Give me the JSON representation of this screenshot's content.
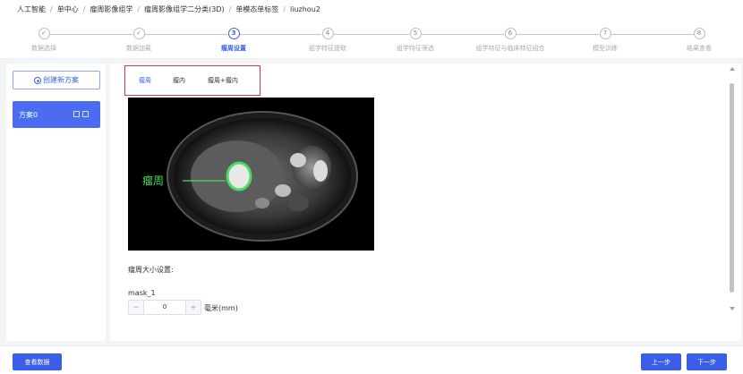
{
  "breadcrumb": [
    "人工智能",
    "单中心",
    "瘤周影像组学",
    "瘤周影像组学二分类(3D)",
    "单模态单标签",
    "liuzhou2"
  ],
  "steps": [
    {
      "num": "✓",
      "label": "数据选择",
      "state": "done"
    },
    {
      "num": "✓",
      "label": "数据加载",
      "state": "done"
    },
    {
      "num": "3",
      "label": "瘤周设置",
      "state": "active"
    },
    {
      "num": "4",
      "label": "组学特征提取",
      "state": "todo"
    },
    {
      "num": "5",
      "label": "组学特征筛选",
      "state": "todo"
    },
    {
      "num": "6",
      "label": "组学特征与临床特征组合",
      "state": "todo"
    },
    {
      "num": "7",
      "label": "模型训练",
      "state": "todo"
    },
    {
      "num": "8",
      "label": "结果查看",
      "state": "todo"
    }
  ],
  "sidebar": {
    "create_label": "创建新方案",
    "plans": [
      {
        "name": "方案0"
      }
    ]
  },
  "tabs": [
    {
      "label": "瘤周",
      "active": true
    },
    {
      "label": "瘤内",
      "active": false
    },
    {
      "label": "瘤周+瘤内",
      "active": false
    }
  ],
  "image": {
    "annotation": "瘤周",
    "annotation_color": "#4cd964"
  },
  "settings": {
    "title": "瘤周大小设置:",
    "mask_label": "mask_1",
    "value": "0",
    "minus": "−",
    "plus": "+",
    "unit": "毫米(mm)"
  },
  "footer": {
    "view_data": "查看数据",
    "prev": "上一步",
    "next": "下一步"
  },
  "colors": {
    "primary": "#3b5ee8",
    "highlight_border": "#d9363e"
  }
}
